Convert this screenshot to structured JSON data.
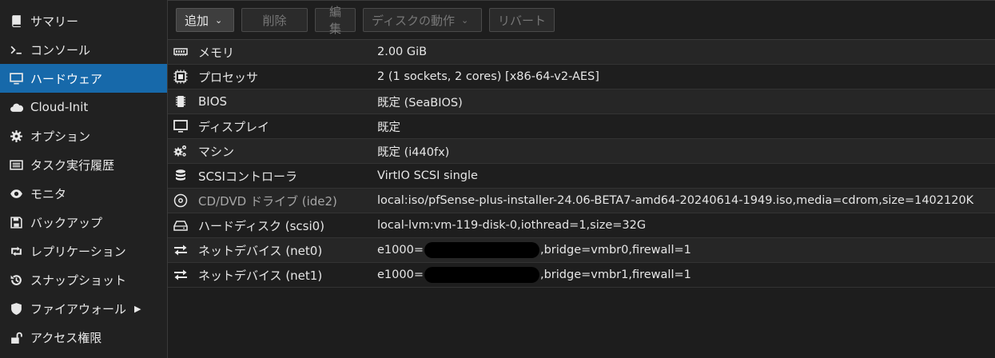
{
  "sidebar": {
    "items": [
      {
        "label": "サマリー",
        "icon": "book-icon"
      },
      {
        "label": "コンソール",
        "icon": "terminal-icon"
      },
      {
        "label": "ハードウェア",
        "icon": "monitor-icon",
        "active": true
      },
      {
        "label": "Cloud-Init",
        "icon": "cloud-icon"
      },
      {
        "label": "オプション",
        "icon": "gear-icon"
      },
      {
        "label": "タスク実行履歴",
        "icon": "list-icon"
      },
      {
        "label": "モニタ",
        "icon": "eye-icon"
      },
      {
        "label": "バックアップ",
        "icon": "floppy-icon"
      },
      {
        "label": "レプリケーション",
        "icon": "retweet-icon"
      },
      {
        "label": "スナップショット",
        "icon": "history-icon"
      },
      {
        "label": "ファイアウォール",
        "icon": "shield-icon",
        "submenu": true
      },
      {
        "label": "アクセス権限",
        "icon": "unlock-icon"
      }
    ]
  },
  "toolbar": {
    "add_label": "追加",
    "delete_label": "削除",
    "edit_label": "編集",
    "disk_action_label": "ディスクの動作",
    "revert_label": "リバート"
  },
  "hardware": {
    "rows": [
      {
        "name": "メモリ",
        "value": "2.00 GiB",
        "icon": "memory-icon"
      },
      {
        "name": "プロセッサ",
        "value": "2 (1 sockets, 2 cores) [x86-64-v2-AES]",
        "icon": "cpu-icon"
      },
      {
        "name": "BIOS",
        "value": "既定 (SeaBIOS)",
        "icon": "chip-icon"
      },
      {
        "name": "ディスプレイ",
        "value": "既定",
        "icon": "display-icon"
      },
      {
        "name": "マシン",
        "value": "既定 (i440fx)",
        "icon": "cogs-icon"
      },
      {
        "name": "SCSIコントローラ",
        "value": "VirtIO SCSI single",
        "icon": "database-icon"
      },
      {
        "name": "CD/DVD ドライブ (ide2)",
        "value": "local:iso/pfSense-plus-installer-24.06-BETA7-amd64-20240614-1949.iso,media=cdrom,size=1402120K",
        "icon": "cdrom-icon",
        "dim": true
      },
      {
        "name": "ハードディスク (scsi0)",
        "value": "local-lvm:vm-119-disk-0,iothread=1,size=32G",
        "icon": "hdd-icon"
      },
      {
        "name": "ネットデバイス (net0)",
        "value_prefix": "e1000=",
        "value_suffix": ",bridge=vmbr0,firewall=1",
        "icon": "exchange-icon"
      },
      {
        "name": "ネットデバイス (net1)",
        "value_prefix": "e1000=",
        "value_suffix": ",bridge=vmbr1,firewall=1",
        "icon": "exchange-icon"
      }
    ]
  }
}
